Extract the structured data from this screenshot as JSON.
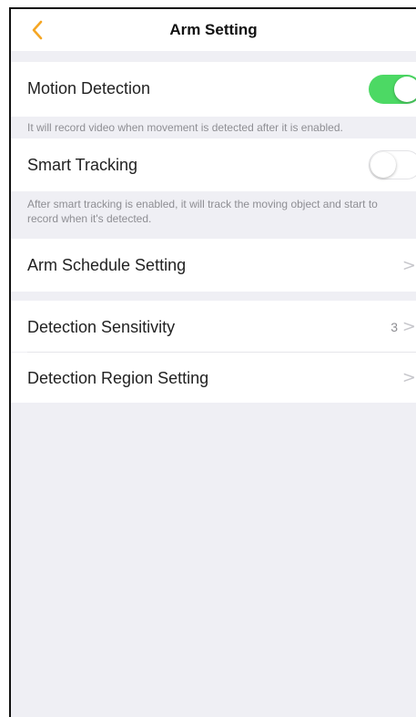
{
  "header": {
    "title": "Arm Setting",
    "back_icon": "chevron-left-icon",
    "accent": "#f5a623"
  },
  "motion_detection": {
    "label": "Motion Detection",
    "enabled": true,
    "hint": "It will record video when movement is detected after it is enabled."
  },
  "smart_tracking": {
    "label": "Smart Tracking",
    "enabled": false,
    "hint": "After smart tracking is enabled, it will track the moving object and start to record when it's detected."
  },
  "arm_schedule": {
    "label": "Arm Schedule Setting",
    "chevron": ">"
  },
  "detection_sensitivity": {
    "label": "Detection Sensitivity",
    "value": "3",
    "chevron": ">"
  },
  "detection_region": {
    "label": "Detection Region Setting",
    "chevron": ">"
  },
  "colors": {
    "toggle_on": "#4cd964",
    "background": "#efeff4"
  }
}
